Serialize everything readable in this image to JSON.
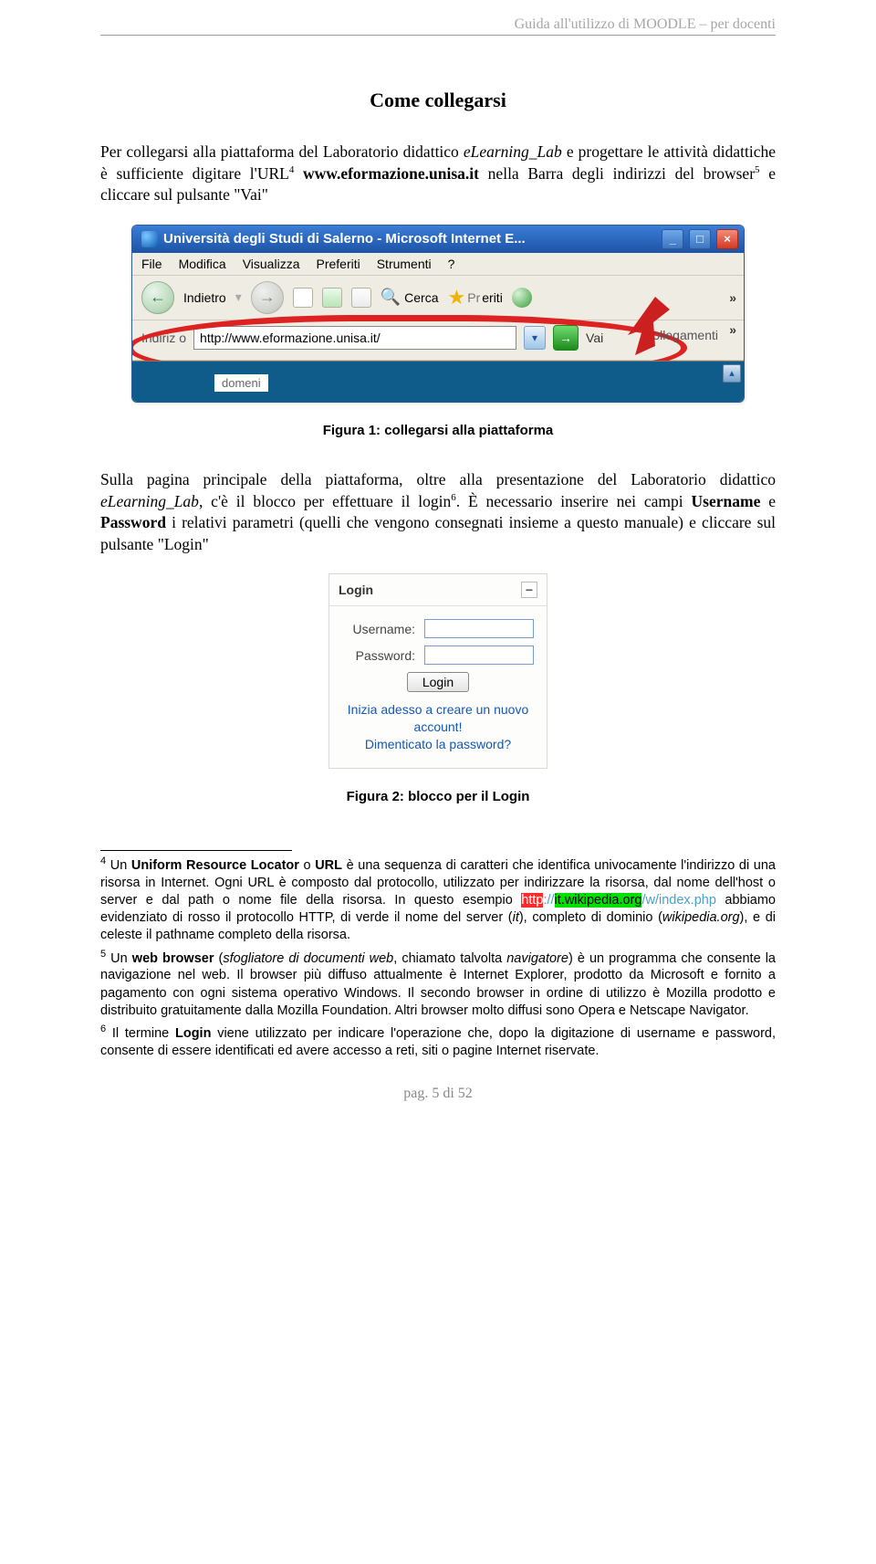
{
  "header": "Guida all'utilizzo di MOODLE – per docenti",
  "section_title": "Come collegarsi",
  "para1_a": "Per collegarsi alla piattaforma del Laboratorio didattico ",
  "para1_lab": "eLearning_Lab",
  "para1_b": " e progettare le attività didattiche è sufficiente digitare l'URL",
  "para1_ref4": "4",
  "para1_c": " ",
  "para1_url": "www.eformazione.unisa.it",
  "para1_d": " nella Barra degli indirizzi del browser",
  "para1_ref5": "5",
  "para1_e": " e cliccare sul pulsante \"Vai\"",
  "browser": {
    "title": "Università degli Studi di Salerno - Microsoft Internet E...",
    "menu": [
      "File",
      "Modifica",
      "Visualizza",
      "Preferiti",
      "Strumenti",
      "?"
    ],
    "back": "Indietro",
    "search": "Cerca",
    "favorites": "eriti",
    "addr_label": "Indiriz",
    "addr_value": "http://www.eformazione.unisa.it/",
    "vai": "Vai",
    "collegamenti": "Collegamenti",
    "domeni": "domeni"
  },
  "fig1_caption": "Figura 1: collegarsi alla piattaforma",
  "para2_a": "Sulla pagina principale della piattaforma, oltre alla presentazione del Laboratorio didattico ",
  "para2_lab": "eLearning_Lab",
  "para2_b": ", c'è il blocco per effettuare il login",
  "para2_ref6": "6",
  "para2_c": ". È necessario inserire nei campi ",
  "para2_user": "Username",
  "para2_and": " e ",
  "para2_pass": "Password",
  "para2_d": " i relativi parametri (quelli che vengono consegnati insieme a questo manuale) e cliccare sul pulsante \"Login\"",
  "login": {
    "head": "Login",
    "username_label": "Username:",
    "password_label": "Password:",
    "button": "Login",
    "link1": "Inizia adesso a creare un nuovo account!",
    "link2": "Dimenticato la password?"
  },
  "fig2_caption": "Figura 2: blocco per il Login",
  "footnotes": {
    "fn4_a": " Un ",
    "fn4_b": "Uniform Resource Locator",
    "fn4_c": " o ",
    "fn4_d": "URL",
    "fn4_e": " è una sequenza di caratteri che identifica univocamente l'indirizzo di una risorsa in Internet. Ogni URL è composto dal protocollo, utilizzato per indirizzare la risorsa, dal nome dell'host o server e dal path o nome file della risorsa. In questo esempio ",
    "fn4_http": "http",
    "fn4_sep1": "://",
    "fn4_host": "it.wikipedia.org",
    "fn4_path": "/w/index.php",
    "fn4_f": " abbiamo evidenziato di rosso il protocollo HTTP, di verde il nome del server (",
    "fn4_it": "it",
    "fn4_g": "), completo di dominio (",
    "fn4_wiki": "wikipedia.org",
    "fn4_h": "), e di celeste il pathname completo della risorsa.",
    "fn5_a": " Un ",
    "fn5_b": "web browser",
    "fn5_c": " (",
    "fn5_d": "sfogliatore di documenti web",
    "fn5_e": ", chiamato talvolta ",
    "fn5_f": "navigatore",
    "fn5_g": ") è un programma che consente la navigazione nel web. Il browser più diffuso attualmente è Internet Explorer, prodotto da Microsoft e fornito a pagamento con ogni sistema operativo Windows. Il secondo browser in ordine di utilizzo è Mozilla prodotto e distribuito gratuitamente dalla Mozilla Foundation. Altri browser molto diffusi sono Opera e Netscape Navigator.",
    "fn6_a": " Il termine ",
    "fn6_b": "Login",
    "fn6_c": " viene utilizzato per indicare l'operazione che, dopo la digitazione di username e password, consente di essere identificati ed avere accesso a reti, siti o pagine Internet riservate."
  },
  "footer": "pag. 5 di 52"
}
